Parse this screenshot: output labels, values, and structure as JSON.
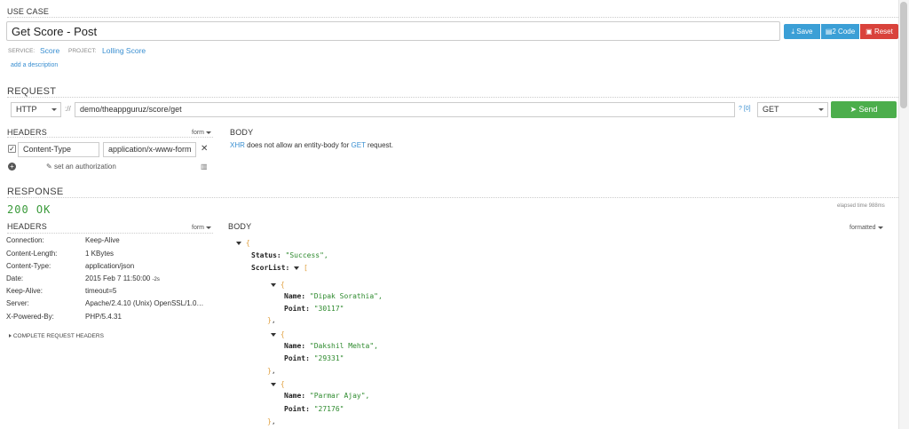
{
  "use_case": {
    "label": "USE CASE",
    "title": "Get Score - Post",
    "buttons": {
      "save": "Save",
      "code": "2 Code",
      "reset": "Reset"
    },
    "service_label": "SERVICE:",
    "service": "Score",
    "project_label": "PROJECT:",
    "project": "Lolling Score",
    "add_description": "add a description"
  },
  "request": {
    "label": "REQUEST",
    "protocol": "HTTP",
    "scheme_sep": "://",
    "url": "demo/theappguruz/score/get",
    "params_badge": "? [0]",
    "method": "GET",
    "send": "Send",
    "headers_label": "HEADERS",
    "form_label": "form",
    "header_row": {
      "key": "Content-Type",
      "value": "application/x-www-form"
    },
    "set_authorization": "set an authorization",
    "body_label": "BODY",
    "body_note_xhr": "XHR",
    "body_note_mid": " does not allow an entity-body for ",
    "body_note_get": "GET",
    "body_note_end": " request."
  },
  "response": {
    "label": "RESPONSE",
    "status": "200 OK",
    "elapsed": "elapsed time 988ms",
    "headers_label": "HEADERS",
    "form_label": "form",
    "body_label": "BODY",
    "formatted_label": "formatted",
    "headers": [
      {
        "key": "Connection:",
        "value": "Keep-Alive",
        "suffix": ""
      },
      {
        "key": "Content-Length:",
        "value": "1 KBytes",
        "suffix": ""
      },
      {
        "key": "Content-Type:",
        "value": "application/json",
        "suffix": ""
      },
      {
        "key": "Date:",
        "value": "2015 Feb 7 11:50:00",
        "suffix": "-2s"
      },
      {
        "key": "Keep-Alive:",
        "value": "timeout=5",
        "suffix": ""
      },
      {
        "key": "Server:",
        "value": "Apache/2.4.10 (Unix) OpenSSL/1.0…",
        "suffix": ""
      },
      {
        "key": "X-Powered-By:",
        "value": "PHP/5.4.31",
        "suffix": ""
      }
    ],
    "complete_headers": "COMPLETE REQUEST HEADERS",
    "json": {
      "status_key": "Status:",
      "status_val": "\"Success\",",
      "list_key": "ScorList:",
      "name_key": "Name:",
      "point_key": "Point:",
      "items": [
        {
          "name": "\"Dipak Sorathia\",",
          "point": "\"30117\""
        },
        {
          "name": "\"Dakshil Mehta\",",
          "point": "\"29331\""
        },
        {
          "name": "\"Parmar Ajay\",",
          "point": "\"27176\""
        }
      ]
    }
  },
  "colors": {
    "save": "#3b9fd6",
    "code": "#3b9fd6",
    "reset": "#d9423b",
    "send": "#4cae4c",
    "status": "#3a9a3a",
    "link": "#3a8fd1"
  }
}
